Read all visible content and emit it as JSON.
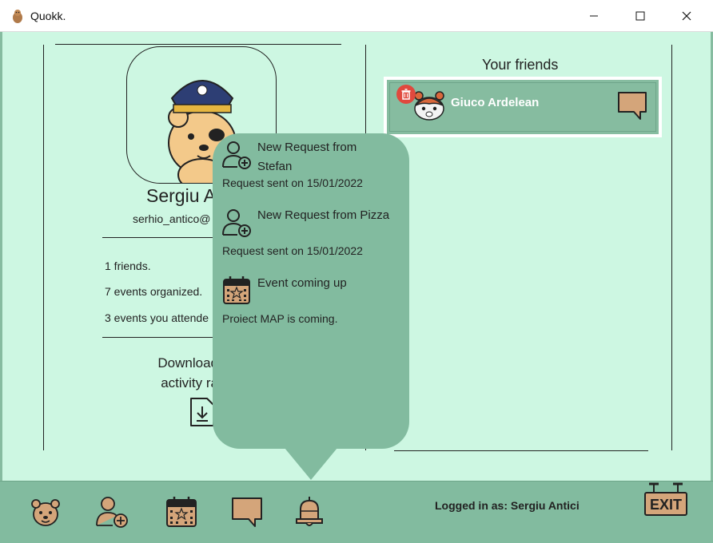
{
  "window": {
    "title": "Quokk.",
    "controls": {
      "minimize": "minimize-icon",
      "maximize": "maximize-icon",
      "close": "close-icon"
    }
  },
  "profile": {
    "name": "Sergiu A",
    "email": "serhio_antico@",
    "stats": [
      "1 friends.",
      "7 events organized.",
      "3 events you attende"
    ],
    "download_label_line1": "Download",
    "download_label_line2": "activity ra",
    "download_icon": "download-file-icon"
  },
  "friends": {
    "title": "Your friends",
    "items": [
      {
        "name": "Giuco Ardelean",
        "avatar": "hamster-avatar-icon",
        "delete_icon": "trash-icon",
        "chat_icon": "chat-icon"
      }
    ]
  },
  "notifications": [
    {
      "icon": "add-user-icon",
      "title_line1": "New Request from",
      "title_line2": "Stefan",
      "subtitle": "Request sent on 15/01/2022"
    },
    {
      "icon": "add-user-icon",
      "title_line1": "New Request from Pizza",
      "title_line2": "",
      "subtitle": "Request sent on 15/01/2022"
    },
    {
      "icon": "calendar-icon",
      "title_line1": "Event coming up",
      "title_line2": "",
      "subtitle": "Proiect MAP is coming."
    }
  ],
  "bottom_nav": {
    "items": [
      "profile-icon",
      "add-friend-icon",
      "calendar-icon",
      "chat-icon",
      "bell-icon"
    ],
    "logged_in": "Logged in as: Sergiu Antici",
    "exit_label": "EXIT"
  },
  "colors": {
    "background": "#cdf7e2",
    "accent": "#86bca0",
    "popup": "#82bb9f",
    "icon_tan": "#d4a57a",
    "delete_red": "#e0493e"
  }
}
